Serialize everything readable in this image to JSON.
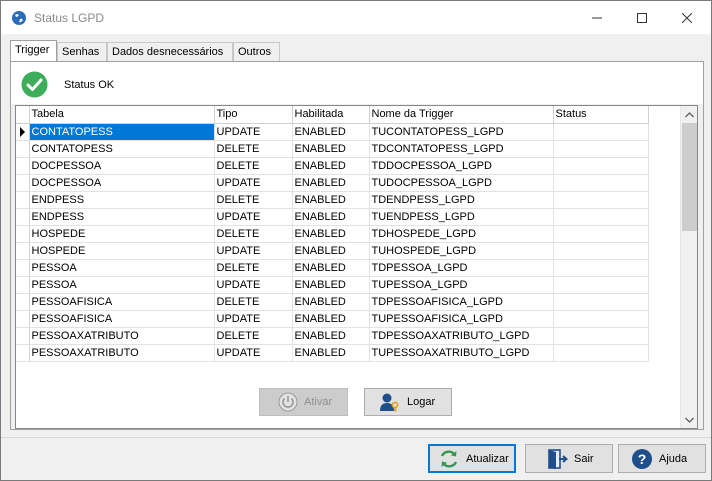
{
  "window": {
    "title": "Status LGPD",
    "icon": "globe-icon",
    "controls": [
      "minimize-icon",
      "maximize-icon",
      "close-icon"
    ]
  },
  "tabs": [
    {
      "label": "Trigger",
      "active": true
    },
    {
      "label": "Senhas",
      "active": false
    },
    {
      "label": "Dados desnecessários",
      "active": false
    },
    {
      "label": "Outros",
      "active": false
    }
  ],
  "status": {
    "icon": "check-circle-icon",
    "text": "Status OK",
    "color": "#3cae5a"
  },
  "table": {
    "columns": [
      "Tabela",
      "Tipo",
      "Habilitada",
      "Nome da Trigger",
      "Status"
    ],
    "rows": [
      [
        "CONTATOPESS",
        "UPDATE",
        "ENABLED",
        "TUCONTATOPESS_LGPD",
        ""
      ],
      [
        "CONTATOPESS",
        "DELETE",
        "ENABLED",
        "TDCONTATOPESS_LGPD",
        ""
      ],
      [
        "DOCPESSOA",
        "DELETE",
        "ENABLED",
        "TDDOCPESSOA_LGPD",
        ""
      ],
      [
        "DOCPESSOA",
        "UPDATE",
        "ENABLED",
        "TUDOCPESSOA_LGPD",
        ""
      ],
      [
        "ENDPESS",
        "DELETE",
        "ENABLED",
        "TDENDPESS_LGPD",
        ""
      ],
      [
        "ENDPESS",
        "UPDATE",
        "ENABLED",
        "TUENDPESS_LGPD",
        ""
      ],
      [
        "HOSPEDE",
        "DELETE",
        "ENABLED",
        "TDHOSPEDE_LGPD",
        ""
      ],
      [
        "HOSPEDE",
        "UPDATE",
        "ENABLED",
        "TUHOSPEDE_LGPD",
        ""
      ],
      [
        "PESSOA",
        "DELETE",
        "ENABLED",
        "TDPESSOA_LGPD",
        ""
      ],
      [
        "PESSOA",
        "UPDATE",
        "ENABLED",
        "TUPESSOA_LGPD",
        ""
      ],
      [
        "PESSOAFISICA",
        "DELETE",
        "ENABLED",
        "TDPESSOAFISICA_LGPD",
        ""
      ],
      [
        "PESSOAFISICA",
        "UPDATE",
        "ENABLED",
        "TUPESSOAFISICA_LGPD",
        ""
      ],
      [
        "PESSOAXATRIBUTO",
        "DELETE",
        "ENABLED",
        "TDPESSOAXATRIBUTO_LGPD",
        ""
      ],
      [
        "PESSOAXATRIBUTO",
        "UPDATE",
        "ENABLED",
        "TUPESSOAXATRIBUTO_LGPD",
        ""
      ]
    ],
    "selected_row": 0,
    "selection_color": "#0078d7"
  },
  "actions": {
    "ativar": {
      "label": "Ativar",
      "icon": "power-icon",
      "enabled": false
    },
    "logar": {
      "label": "Logar",
      "icon": "user-key-icon",
      "enabled": true
    }
  },
  "footer": {
    "atualizar": {
      "label": "Atualizar",
      "icon": "refresh-icon"
    },
    "sair": {
      "label": "Sair",
      "icon": "exit-door-icon"
    },
    "ajuda": {
      "label": "Ajuda",
      "icon": "help-icon"
    }
  }
}
